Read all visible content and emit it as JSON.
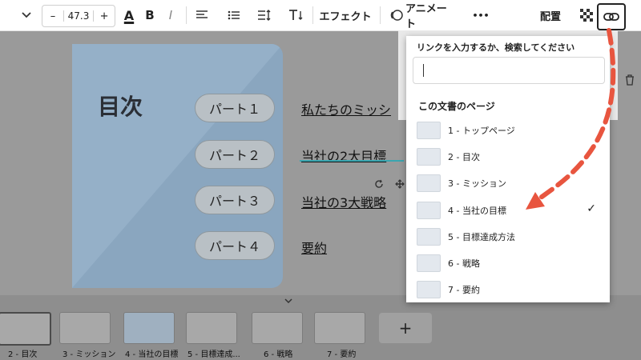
{
  "toolbar": {
    "font_size": "47.3",
    "minus": "–",
    "plus": "+",
    "color_glyph": "A",
    "bold_glyph": "B",
    "italic_glyph": "I",
    "effect_label": "エフェクト",
    "animate_label": "アニメート",
    "more_glyph": "•••",
    "arrange_label": "配置"
  },
  "slide": {
    "title": "目次",
    "pills": [
      "パート１",
      "パート２",
      "パート３",
      "パート４"
    ],
    "links": [
      "私たちのミッシ",
      "当社の2大目標",
      "当社の3大戦略",
      "要約"
    ]
  },
  "popover": {
    "prompt": "リンクを入力するか、検索してください",
    "input_value": "",
    "section_title": "この文書のページ",
    "pages": [
      {
        "label": "1 - トップページ",
        "selected": false
      },
      {
        "label": "2 - 目次",
        "selected": false
      },
      {
        "label": "3 - ミッション",
        "selected": false
      },
      {
        "label": "4 - 当社の目標",
        "selected": true
      },
      {
        "label": "5 - 目標達成方法",
        "selected": false
      },
      {
        "label": "6 - 戦略",
        "selected": false
      },
      {
        "label": "7 - 要約",
        "selected": false
      }
    ],
    "check_glyph": "✓"
  },
  "thumbnails": {
    "labels": [
      "2 - 目次",
      "3 - ミッション",
      "4 - 当社の目標",
      "5 - 目標達成...",
      "6 - 戦略",
      "7 - 要約"
    ],
    "add_glyph": "+"
  },
  "colors": {
    "annotation_arrow": "#e8553f",
    "accent_teal": "#3aa6b0"
  },
  "icons": [
    "chevron-down-icon",
    "text-color-icon",
    "bold-icon",
    "italic-icon",
    "align-left-icon",
    "list-icon",
    "line-spacing-icon",
    "text-direction-icon",
    "animate-icon",
    "more-icon",
    "transparency-icon",
    "link-icon",
    "trash-icon"
  ]
}
